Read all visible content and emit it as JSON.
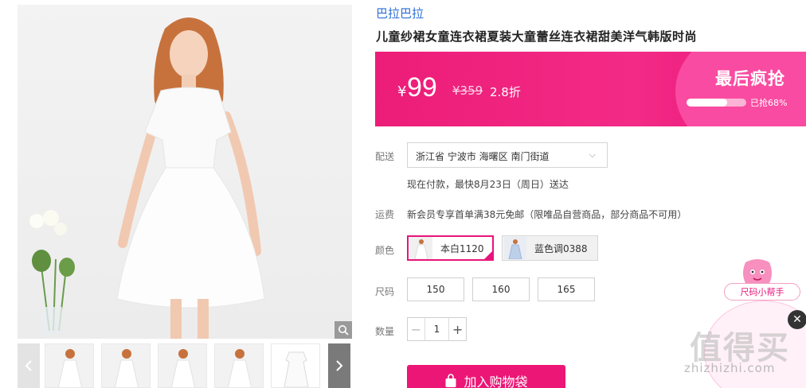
{
  "product": {
    "brand": "巴拉巴拉",
    "title": "儿童纱裙女童连衣裙夏装大童蕾丝连衣裙甜美洋气韩版时尚"
  },
  "price": {
    "currency": "¥",
    "amount": "99",
    "original": "¥359",
    "discount": "2.8折",
    "rush_label": "最后疯抢",
    "progress_fraction": 0.68,
    "progress_text": "已抢68%"
  },
  "delivery": {
    "label": "配送",
    "address": "浙江省 宁波市 海曙区 南门街道",
    "estimate": "现在付款，最快8月23日（周日）送达"
  },
  "shipping": {
    "label": "运费",
    "text": "新会员专享首单满38元免邮（限唯品自营商品，部分商品不可用）"
  },
  "color": {
    "label": "颜色",
    "options": [
      "本白1120",
      "蓝色调0388"
    ],
    "selected": 0
  },
  "size": {
    "label": "尺码",
    "options": [
      "150",
      "160",
      "165"
    ]
  },
  "quantity": {
    "label": "数量",
    "value": "1",
    "minus": "−",
    "plus": "+"
  },
  "cart_button": "加入购物袋",
  "size_helper": {
    "tag": "尺码小帮手",
    "close": "✕"
  },
  "watermark": {
    "logo": "值得买",
    "url": "zhizhizhi.com"
  },
  "colors": {
    "accent": "#ec1677",
    "brand_link": "#2c6fd6"
  }
}
